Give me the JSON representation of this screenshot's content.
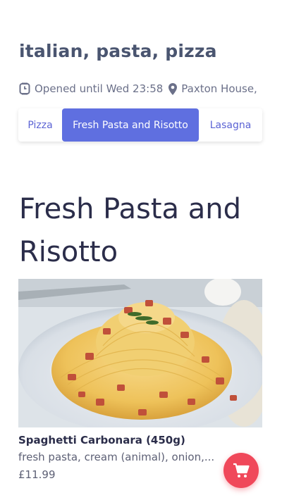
{
  "restaurant": {
    "title": "italian, pasta, pizza",
    "hours": "Opened until Wed 23:58",
    "location": "Paxton House,"
  },
  "categories": {
    "tabs": [
      {
        "label": "Pizza"
      },
      {
        "label": "Fresh Pasta and Risotto",
        "active": true
      },
      {
        "label": "Lasagna"
      }
    ]
  },
  "section": {
    "heading": "Fresh Pasta and Risotto"
  },
  "products": [
    {
      "name": "Spaghetti Carbonara (450g)",
      "description": "fresh pasta, cream (animal), onion,...",
      "price": "£11.99",
      "image_icon": "spaghetti-carbonara-photo"
    }
  ],
  "cart": {
    "icon": "cart-icon",
    "color": "#f0485a"
  },
  "theme": {
    "accent": "#5f6fe0"
  }
}
